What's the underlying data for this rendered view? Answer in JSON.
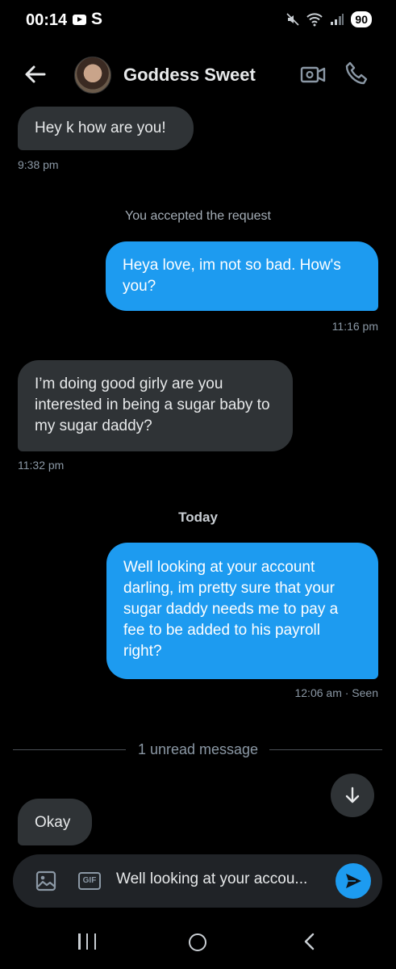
{
  "status_bar": {
    "time": "00:14",
    "s_label": "S",
    "battery": "90"
  },
  "header": {
    "contact_name": "Goddess Sweet"
  },
  "messages": [
    {
      "text": "Hey k how are you!",
      "time": "9:38 pm"
    },
    {
      "text": "Heya love, im not so bad. How's you?",
      "time": "11:16 pm"
    },
    {
      "text": "I’m doing good girly are you interested in being a sugar baby to my sugar daddy?",
      "time": "11:32 pm"
    },
    {
      "text": "Well looking at your account darling, im pretty sure that your sugar daddy needs me to pay a fee to be added to his payroll right?",
      "time": "12:06 am · Seen"
    },
    {
      "text": "Okay"
    }
  ],
  "notes": {
    "accepted": "You accepted the request",
    "today": "Today",
    "unread": "1 unread message"
  },
  "composer": {
    "draft": "Well looking at your accou...",
    "gif_label": "GIF"
  },
  "colors": {
    "sent_bubble": "#1d9bf0",
    "received_bubble": "#2f3336",
    "background": "#000000"
  }
}
